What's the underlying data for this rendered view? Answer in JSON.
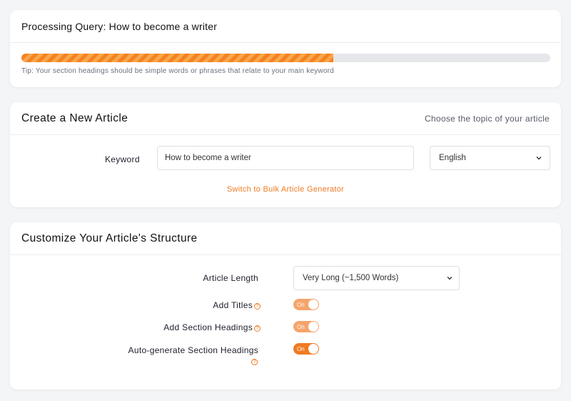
{
  "processing": {
    "title": "Processing Query: How to become a writer",
    "progress_percent": 59,
    "tip": "Tip: Your section headings should be simple words or phrases that relate to your main keyword"
  },
  "create": {
    "title": "Create a New Article",
    "hint": "Choose the topic of your article",
    "keyword_label": "Keyword",
    "keyword_value": "How to become a writer",
    "language_value": "English",
    "bulk_link": "Switch to Bulk Article Generator"
  },
  "structure": {
    "title": "Customize Your Article's Structure",
    "length_label": "Article Length",
    "length_value": "Very Long (~1,500 Words)",
    "titles_label": "Add Titles",
    "section_headings_label": "Add Section Headings",
    "auto_headings_label": "Auto-generate Section Headings",
    "toggle_on": "On",
    "help_glyph": "?"
  },
  "colors": {
    "accent": "#f07a22",
    "progress_stripe": "#f9a64d",
    "toggle_light": "#f6a46c"
  }
}
